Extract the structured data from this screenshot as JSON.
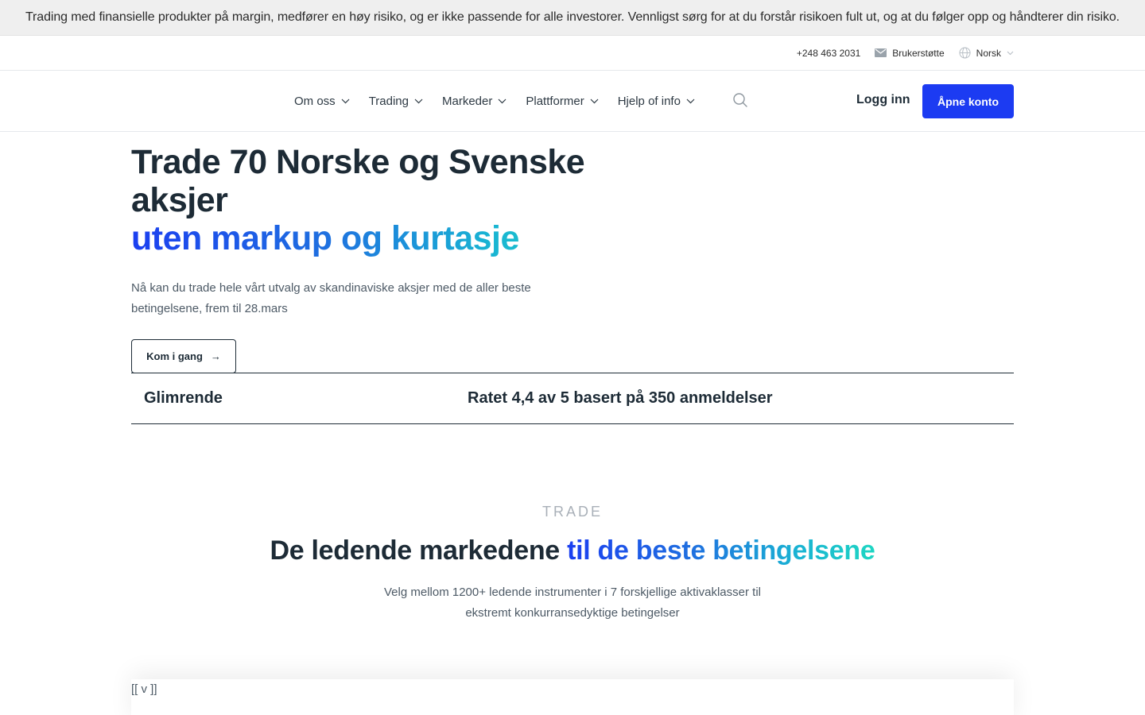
{
  "risk_banner": {
    "text": "Trading med finansielle produkter på margin, medfører en høy risiko, og er ikke passende for alle investorer. Vennligst sørg for at du forstår risikoen fult ut, og at du følger opp og håndterer din risiko."
  },
  "utility_bar": {
    "phone": "+248 463 2031",
    "support": "Brukerstøtte",
    "language": "Norsk"
  },
  "nav": {
    "items": [
      {
        "label": "Om oss"
      },
      {
        "label": "Trading"
      },
      {
        "label": "Markeder"
      },
      {
        "label": "Plattformer"
      },
      {
        "label": "Hjelp of info"
      }
    ],
    "login": "Logg inn",
    "open_account": "Åpne konto"
  },
  "hero": {
    "title_line1": "Trade 70 Norske og Svenske aksjer",
    "title_line2": "uten markup og kurtasje",
    "subtitle": "Nå kan du trade hele vårt utvalg av skandinaviske aksjer med de aller beste betingelsene, frem til 28.mars",
    "cta": "Kom i gang",
    "cta_arrow": "→"
  },
  "rating": {
    "word": "Glimrende",
    "text": "Ratet 4,4 av 5 basert på 350 anmeldelser"
  },
  "markets_section": {
    "eyebrow": "TRADE",
    "title_plain": "De ledende markedene ",
    "title_gradient": "til de beste betingelsene",
    "subtitle_line1": "Velg mellom 1200+ ledende instrumenter i 7 forskjellige aktivaklasser til",
    "subtitle_line2": "ekstremt konkurransedyktige betingelser"
  },
  "card": {
    "placeholder": "[[ v ]]"
  },
  "colors": {
    "accent_blue": "#1c3bf2",
    "gradient_start": "#1b3ff0",
    "gradient_end": "#1ed6c3",
    "text_dark": "#1d2b36"
  }
}
